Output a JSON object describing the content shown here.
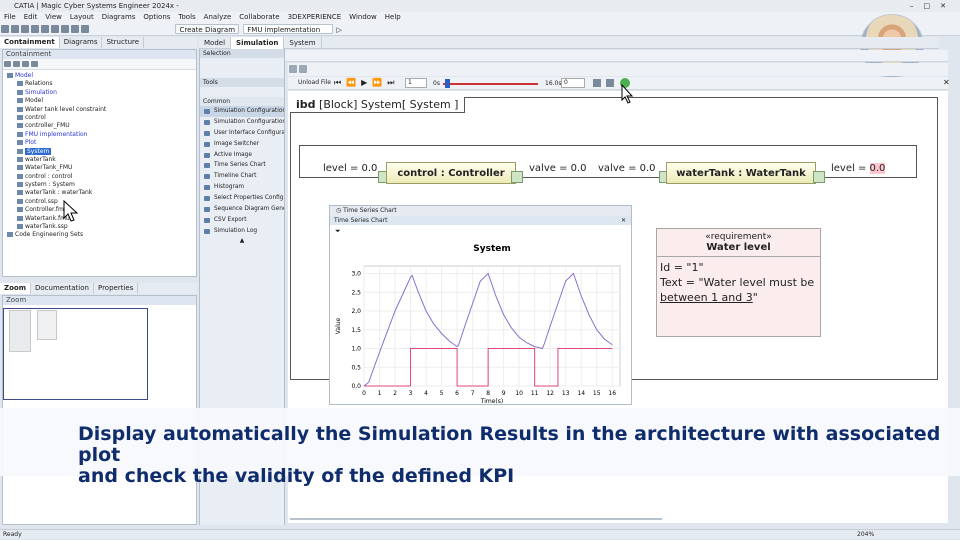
{
  "window": {
    "title": "CATIA | Magic Cyber Systems Engineer 2024x -"
  },
  "menu": [
    "File",
    "Edit",
    "View",
    "Layout",
    "Diagrams",
    "Options",
    "Tools",
    "Analyze",
    "Collaborate",
    "3DEXPERIENCE",
    "Window",
    "Help"
  ],
  "toolbar": {
    "create_diagram": "Create Diagram",
    "fmu_field": "FMU implementation"
  },
  "left_tabs": [
    "Containment",
    "Diagrams",
    "Structure"
  ],
  "containment": {
    "header": "Containment",
    "tree": [
      {
        "label": "Model",
        "indent": 0,
        "blue": true
      },
      {
        "label": "Relations",
        "indent": 1
      },
      {
        "label": "Simulation",
        "indent": 1,
        "blue": true
      },
      {
        "label": "Model",
        "indent": 1
      },
      {
        "label": "Water tank level constraint",
        "indent": 1
      },
      {
        "label": "control",
        "indent": 1
      },
      {
        "label": "controller_FMU",
        "indent": 1
      },
      {
        "label": "FMU implementation",
        "indent": 1,
        "blue": true
      },
      {
        "label": "Plot",
        "indent": 1,
        "blue": true
      },
      {
        "label": "System",
        "indent": 1,
        "selected": true
      },
      {
        "label": "waterTank",
        "indent": 1
      },
      {
        "label": "WaterTank_FMU",
        "indent": 1
      },
      {
        "label": "control : control",
        "indent": 1
      },
      {
        "label": "system : System",
        "indent": 1
      },
      {
        "label": "waterTank : waterTank",
        "indent": 1
      },
      {
        "label": "control.ssp",
        "indent": 1
      },
      {
        "label": "Controller.fmu",
        "indent": 1
      },
      {
        "label": "Watertank.fmu",
        "indent": 1
      },
      {
        "label": "waterTank.ssp",
        "indent": 1
      },
      {
        "label": "Code Engineering Sets",
        "indent": 0
      }
    ]
  },
  "bottom_tabs": [
    "Zoom",
    "Documentation",
    "Properties"
  ],
  "zoom_header": "Zoom",
  "doc_tabs": [
    "Model",
    "Simulation",
    "System"
  ],
  "sim": {
    "unload": "Unload File",
    "step": "1",
    "start": "0s",
    "end": "16.0s",
    "speed": "0"
  },
  "tools_panel": {
    "selection": "Selection",
    "tools": "Tools",
    "common": "Common",
    "items": [
      "Simulation Configuration...",
      "Simulation Configuration",
      "User Interface Configura...",
      "Image Switcher",
      "Active Image",
      "Time Series Chart",
      "Timeline Chart",
      "Histogram",
      "Select Properties Config",
      "Sequence Diagram Gene...",
      "CSV Export",
      "Simulation Log"
    ]
  },
  "ibd": {
    "title_kw": "ibd",
    "title_rest": "[Block] System[ System ]",
    "control_part": "control : Controller",
    "tank_part": "waterTank : WaterTank",
    "level_in": "level = 0.0",
    "valve_out": "valve = 0.0",
    "valve_in": "valve = 0.0",
    "level_label": "level = ",
    "level_val": "0.0"
  },
  "requirement": {
    "stereotype": "«requirement»",
    "name": "Water level",
    "id_line": "Id = \"1\"",
    "text_line1": "Text = \"Water level must be",
    "text_line2": "between 1 and 3",
    "text_end": "\""
  },
  "chart_window": {
    "tab": "Time Series Chart",
    "header": "Time Series Chart"
  },
  "chart_data": {
    "type": "line",
    "title": "System",
    "xlabel": "Time(s)",
    "ylabel": "Value",
    "xlim": [
      0,
      16.5
    ],
    "ylim": [
      0,
      3.2
    ],
    "xticks": [
      0,
      1,
      2,
      3,
      4,
      5,
      6,
      7,
      8,
      9,
      10,
      11,
      12,
      13,
      14,
      15,
      16
    ],
    "yticks": [
      "0,0",
      "0,5",
      "1,0",
      "1,5",
      "2,0",
      "2,5",
      "3,0"
    ],
    "series": [
      {
        "color": "#8b6fcf",
        "x": [
          0,
          0.3,
          1,
          2,
          3,
          3.1,
          3.5,
          4,
          4.5,
          5,
          5.5,
          6,
          6.1,
          6.5,
          7,
          7.5,
          8,
          8.5,
          9,
          9.5,
          10,
          10.5,
          11,
          11.5,
          11.6,
          12,
          12.5,
          13,
          13.5,
          14,
          14.5,
          15,
          15.5,
          16
        ],
        "y": [
          0,
          0.1,
          0.9,
          2.0,
          2.9,
          2.95,
          2.5,
          2.0,
          1.65,
          1.4,
          1.2,
          1.05,
          1.1,
          1.6,
          2.2,
          2.8,
          3.0,
          2.4,
          1.9,
          1.55,
          1.3,
          1.15,
          1.05,
          1.0,
          1.1,
          1.6,
          2.2,
          2.8,
          3.0,
          2.4,
          1.9,
          1.5,
          1.25,
          1.1
        ]
      },
      {
        "color": "#e0467a",
        "x": [
          0,
          3,
          3,
          6,
          6,
          8,
          8,
          11,
          11,
          12.5,
          12.5,
          16
        ],
        "y": [
          0,
          0,
          1,
          1,
          0,
          0,
          1,
          1,
          0,
          0,
          1,
          1
        ]
      }
    ]
  },
  "banner": {
    "line1": "Display automatically the Simulation Results in the architecture with associated plot",
    "line2": "and check the validity of the defined KPI"
  },
  "status": {
    "ready": "Ready",
    "zoom": "204%"
  },
  "colors": {
    "selected": "#2f6bd1",
    "banner_text": "#0f2c6c",
    "level_highlight": "#ffc6cf"
  }
}
